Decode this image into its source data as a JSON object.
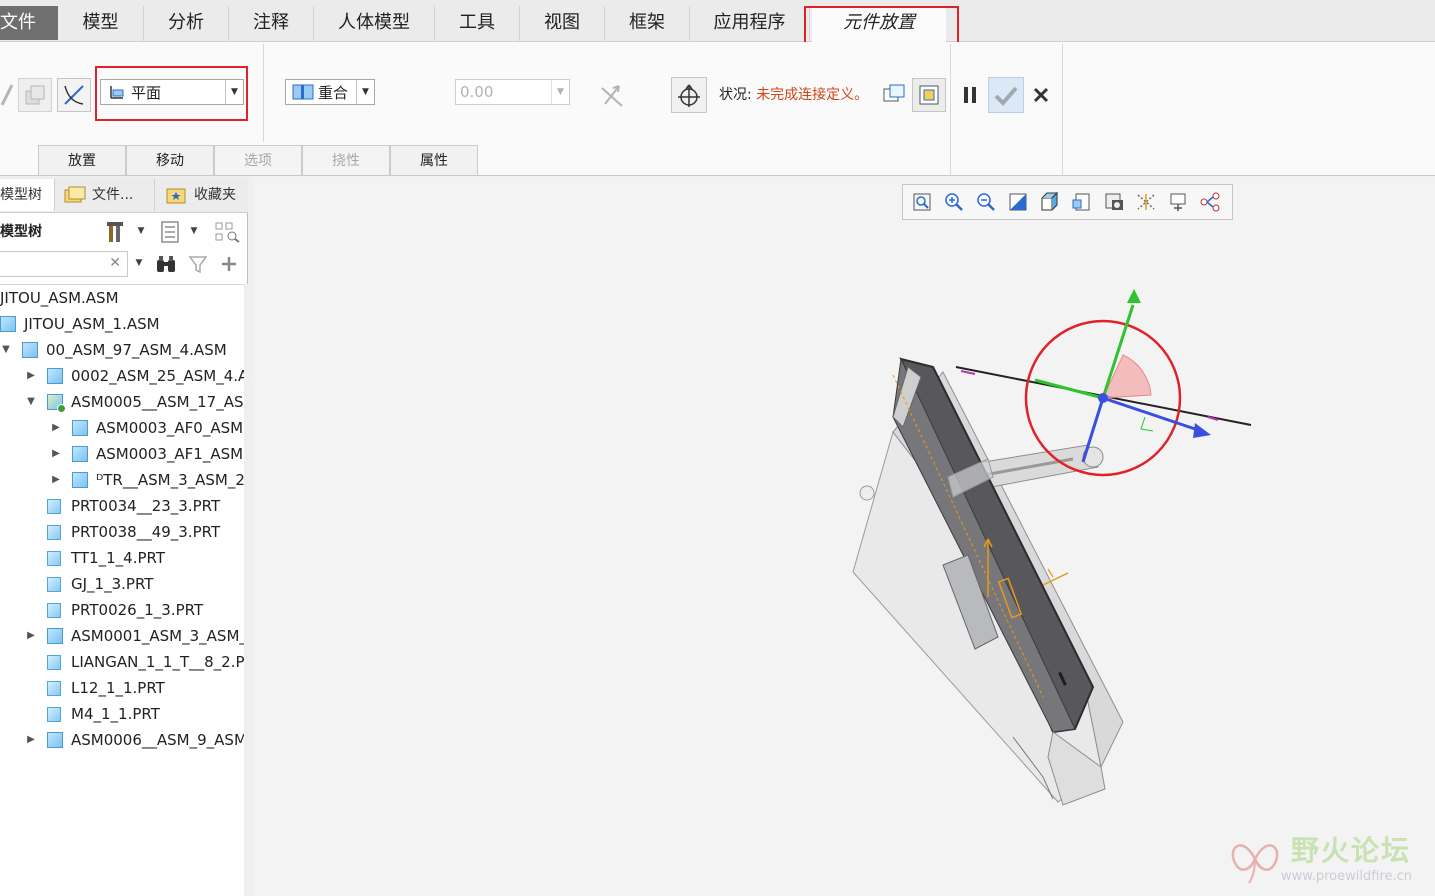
{
  "menu": {
    "tabs": [
      "文件",
      "模型",
      "分析",
      "注释",
      "人体模型",
      "工具",
      "视图",
      "框架",
      "应用程序",
      "元件放置"
    ],
    "active": "元件放置"
  },
  "ribbon": {
    "constraint_type": "平面",
    "placement_mode": "重合",
    "offset_value": "0.00",
    "status_label": "状况:",
    "status_value": "未完成连接定义。",
    "subtabs": [
      "放置",
      "移动",
      "选项",
      "挠性",
      "属性"
    ],
    "disabled_subtabs": [
      "选项",
      "挠性"
    ]
  },
  "panel": {
    "tabs": [
      "模型树",
      "文件...",
      "收藏夹"
    ],
    "header": "模型树",
    "search_value": ""
  },
  "tree": [
    {
      "label": "JITOU_ASM.ASM",
      "level": 0,
      "expander": "",
      "icon": "none"
    },
    {
      "label": "JITOU_ASM_1.ASM",
      "level": 0,
      "expander": "",
      "icon": "asm"
    },
    {
      "label": "00_ASM_97_ASM_4.ASM",
      "level": 0,
      "expander": "▼",
      "icon": "asm"
    },
    {
      "label": "0002_ASM_25_ASM_4.A",
      "level": 1,
      "expander": "▶",
      "icon": "asm"
    },
    {
      "label": "ASM0005__ASM_17_AS",
      "level": 1,
      "expander": "▼",
      "icon": "asm-active"
    },
    {
      "label": "ASM0003_AF0_ASM",
      "level": 2,
      "expander": "▶",
      "icon": "asm"
    },
    {
      "label": "ASM0003_AF1_ASM",
      "level": 2,
      "expander": "▶",
      "icon": "asm"
    },
    {
      "label": "ᴰTR__ASM_3_ASM_2",
      "level": 2,
      "expander": "▶",
      "icon": "asm"
    },
    {
      "label": "PRT0034__23_3.PRT",
      "level": 1,
      "expander": "",
      "icon": "prt"
    },
    {
      "label": "PRT0038__49_3.PRT",
      "level": 1,
      "expander": "",
      "icon": "prt"
    },
    {
      "label": "TT1_1_4.PRT",
      "level": 1,
      "expander": "",
      "icon": "prt"
    },
    {
      "label": "GJ_1_3.PRT",
      "level": 1,
      "expander": "",
      "icon": "prt"
    },
    {
      "label": "PRT0026_1_3.PRT",
      "level": 1,
      "expander": "",
      "icon": "prt"
    },
    {
      "label": "ASM0001_ASM_3_ASM_",
      "level": 1,
      "expander": "▶",
      "icon": "asm"
    },
    {
      "label": "LIANGAN_1_1_T__8_2.PI",
      "level": 1,
      "expander": "",
      "icon": "prt"
    },
    {
      "label": "L12_1_1.PRT",
      "level": 1,
      "expander": "",
      "icon": "prt"
    },
    {
      "label": "M4_1_1.PRT",
      "level": 1,
      "expander": "",
      "icon": "prt"
    },
    {
      "label": "ASM0006__ASM_9_ASM",
      "level": 1,
      "expander": "▶",
      "icon": "asm"
    }
  ],
  "watermark": {
    "title": "野火论坛",
    "url": "www.proewildfire.cn"
  },
  "colors": {
    "highlight_red": "#e0222a",
    "status_warning": "#d0461b",
    "axis_green": "#2ec42e",
    "axis_blue": "#3a4ee0",
    "trajectory_orange": "#e89a12"
  }
}
